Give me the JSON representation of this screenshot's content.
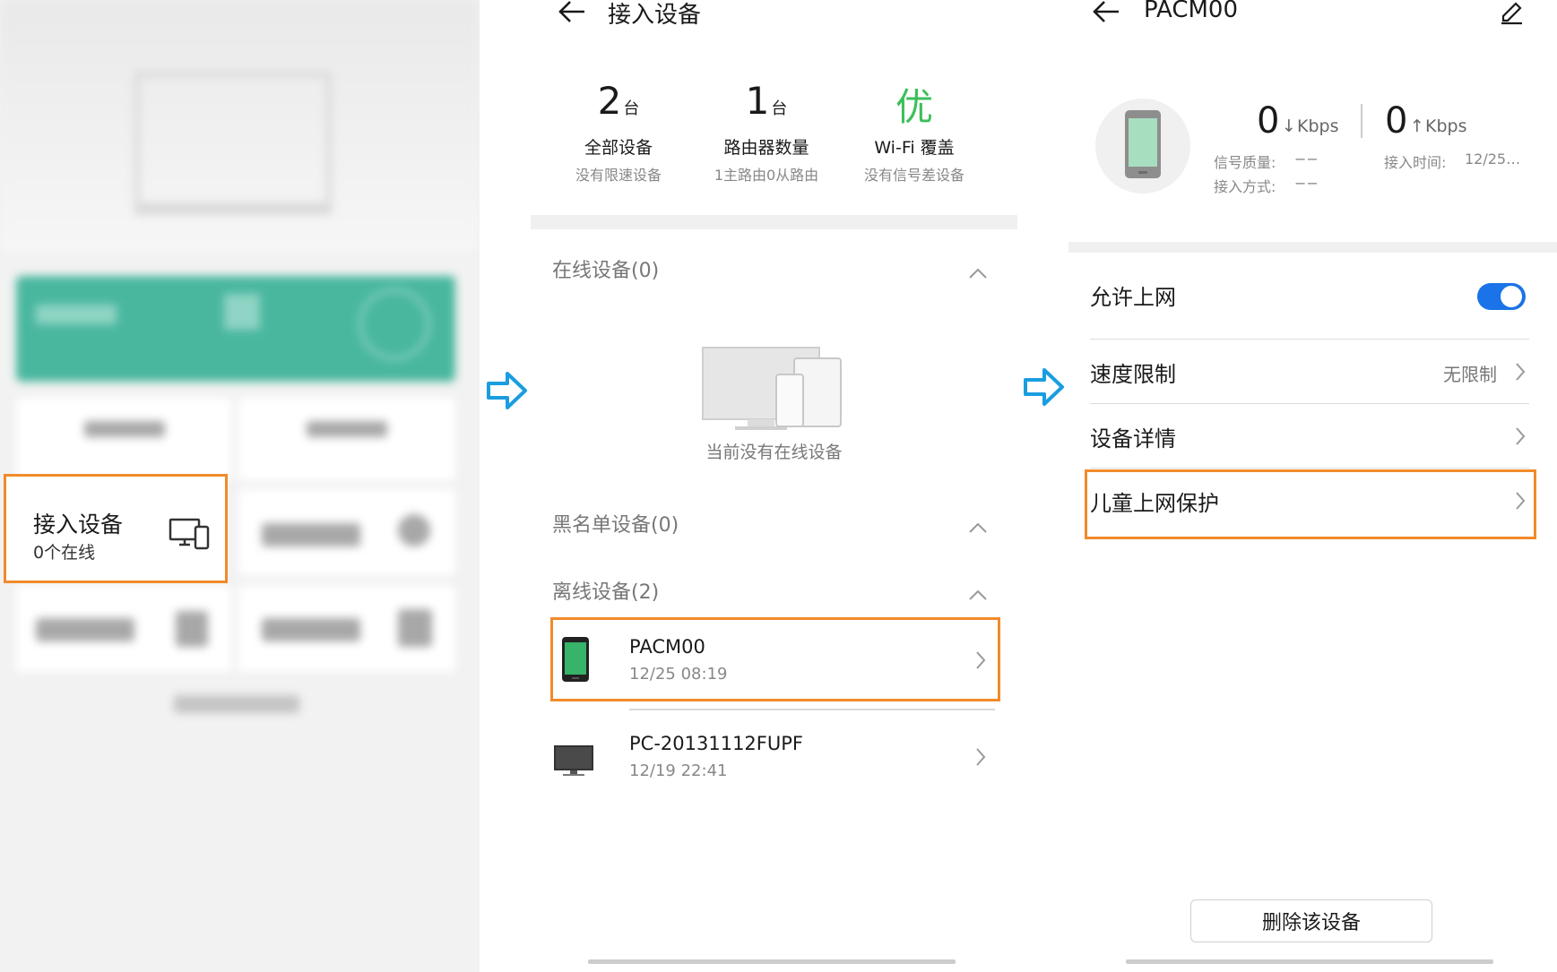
{
  "colors": {
    "highlight": "#f28a2a",
    "arrow": "#1a9de0",
    "accent_green": "#3cbf5a",
    "toggle_blue": "#1a73e8"
  },
  "panel1": {
    "connected_devices": {
      "title": "接入设备",
      "subtitle": "0个在线",
      "icon": "devices-icon"
    }
  },
  "panel2": {
    "header": {
      "title": "接入设备",
      "back_icon": "back-arrow-icon"
    },
    "stats": [
      {
        "value": "2",
        "unit": "台",
        "label": "全部设备",
        "sub": "没有限速设备"
      },
      {
        "value": "1",
        "unit": "台",
        "label": "路由器数量",
        "sub": "1主路由0从路由"
      },
      {
        "value": "优",
        "unit": "",
        "label": "Wi-Fi 覆盖",
        "sub": "没有信号差设备"
      }
    ],
    "sections": {
      "online": "在线设备(0)",
      "empty_text": "当前没有在线设备",
      "blacklist": "黑名单设备(0)",
      "offline": "离线设备(2)"
    },
    "devices": [
      {
        "name": "PACM00",
        "time": "12/25 08:19",
        "icon": "phone-icon"
      },
      {
        "name": "PC-20131112FUPF",
        "time": "12/19 22:41",
        "icon": "monitor-icon"
      }
    ]
  },
  "panel3": {
    "header": {
      "title": "PACM00",
      "back_icon": "back-arrow-icon",
      "edit_icon": "edit-icon"
    },
    "download": {
      "value": "0",
      "unit": "Kbps"
    },
    "upload": {
      "value": "0",
      "unit": "Kbps"
    },
    "info": {
      "signal_label": "信号质量:",
      "signal_value": "−−",
      "access_mode_label": "接入方式:",
      "access_mode_value": "−−",
      "access_time_label": "接入时间:",
      "access_time_value": "12/25…"
    },
    "settings": {
      "allow_internet": "允许上网",
      "speed_limit": "速度限制",
      "speed_limit_value": "无限制",
      "device_details": "设备详情",
      "child_protection": "儿童上网保护"
    },
    "delete_button": "删除该设备"
  }
}
